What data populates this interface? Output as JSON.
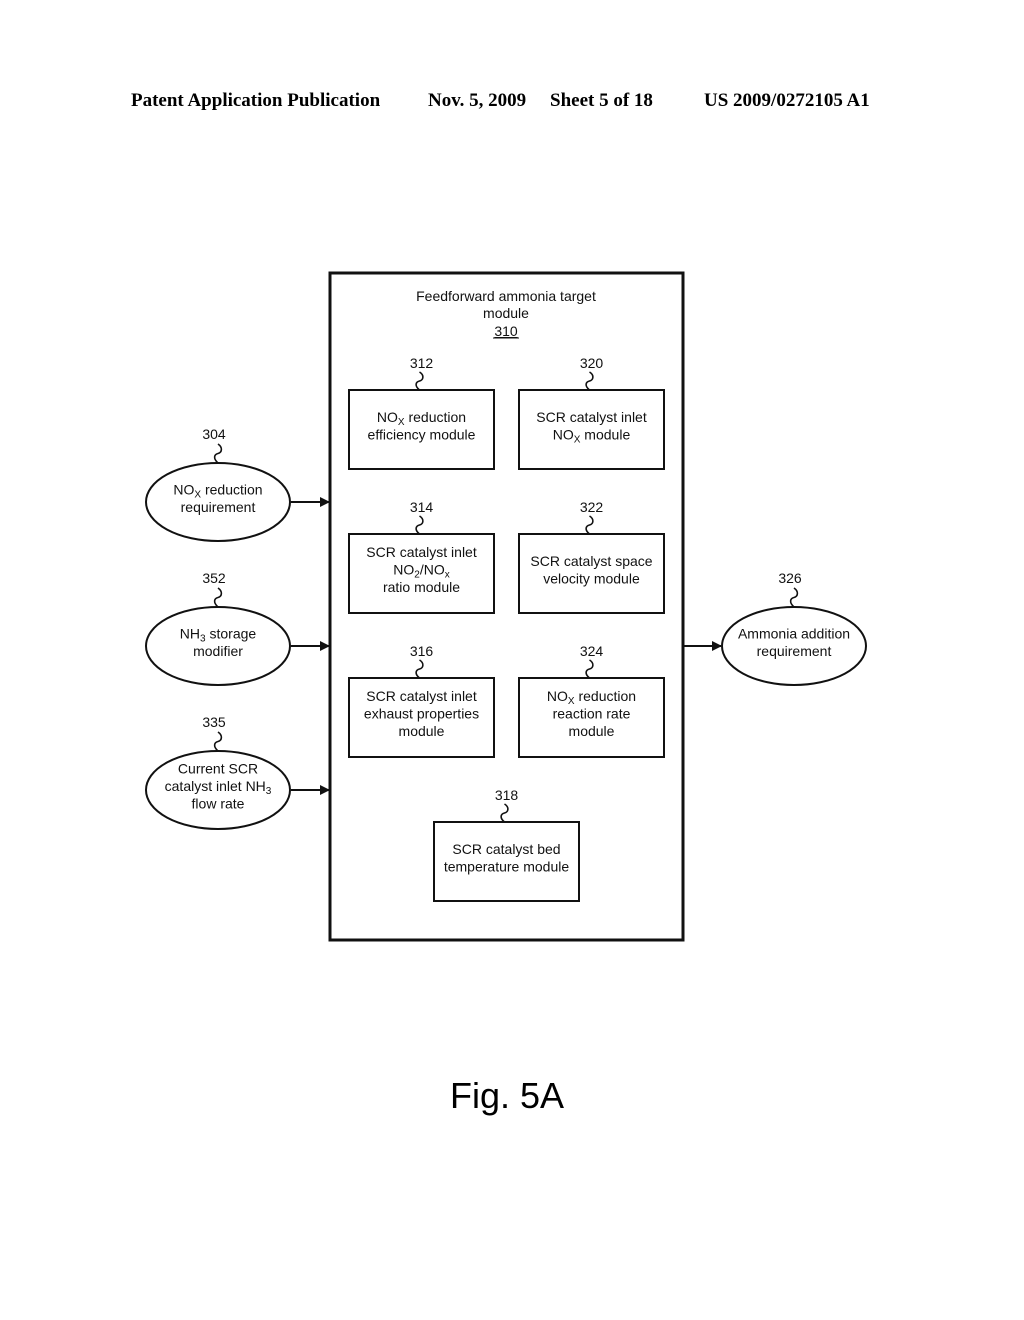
{
  "header": {
    "publication": "Patent Application Publication",
    "date": "Nov. 5, 2009",
    "sheet": "Sheet 5 of 18",
    "number": "US 2009/0272105 A1"
  },
  "main_module": {
    "title_line1": "Feedforward ammonia target",
    "title_line2": "module",
    "ref": "310"
  },
  "modules": [
    {
      "ref": "312",
      "lines": [
        [
          "NO",
          "X",
          " reduction"
        ],
        [
          "efficiency module"
        ]
      ]
    },
    {
      "ref": "320",
      "lines": [
        [
          "SCR catalyst inlet"
        ],
        [
          "NO",
          "X",
          " module"
        ]
      ]
    },
    {
      "ref": "314",
      "lines": [
        [
          "SCR catalyst inlet"
        ],
        [
          "NO",
          "2",
          "/NO",
          "x"
        ],
        [
          "ratio module"
        ]
      ]
    },
    {
      "ref": "322",
      "lines": [
        [
          "SCR catalyst space"
        ],
        [
          "velocity module"
        ]
      ]
    },
    {
      "ref": "316",
      "lines": [
        [
          "SCR catalyst inlet"
        ],
        [
          "exhaust properties"
        ],
        [
          "module"
        ]
      ]
    },
    {
      "ref": "324",
      "lines": [
        [
          "NO",
          "X",
          " reduction"
        ],
        [
          "reaction rate"
        ],
        [
          "module"
        ]
      ]
    },
    {
      "ref": "318",
      "lines": [
        [
          "SCR catalyst bed"
        ],
        [
          "temperature module"
        ]
      ]
    }
  ],
  "inputs": [
    {
      "ref": "304",
      "lines": [
        [
          "NO",
          "X",
          " reduction"
        ],
        [
          "requirement"
        ]
      ]
    },
    {
      "ref": "352",
      "lines": [
        [
          "NH",
          "3",
          " storage"
        ],
        [
          "modifier"
        ]
      ]
    },
    {
      "ref": "335",
      "lines": [
        [
          "Current SCR"
        ],
        [
          "catalyst inlet NH",
          "3"
        ],
        [
          "flow rate"
        ]
      ]
    }
  ],
  "output": {
    "ref": "326",
    "lines": [
      [
        "Ammonia addition"
      ],
      [
        "requirement"
      ]
    ]
  },
  "figure_label": "Fig. 5A"
}
